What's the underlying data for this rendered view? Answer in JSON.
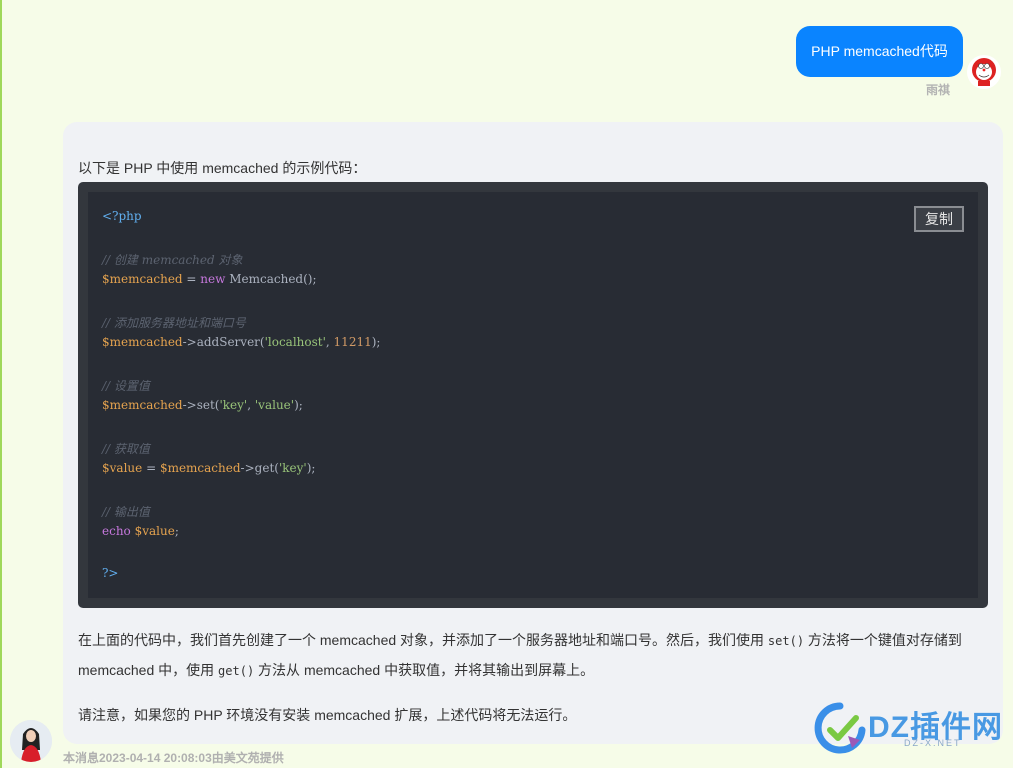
{
  "user_message": {
    "text": "PHP memcached代码",
    "sender": "雨祺"
  },
  "bot_message": {
    "intro": "以下是 PHP 中使用 memcached 的示例代码：",
    "copy_label": "复制",
    "code": {
      "open_tag": "<?php",
      "c1": "// 创建 memcached 对象",
      "l1_var": "$memcached",
      "l1_eq": " = ",
      "l1_kw": "new",
      "l1_rest": " Memcached();",
      "c2": "// 添加服务器地址和端口号",
      "l2_var": "$memcached",
      "l2_call": "->addServer(",
      "l2_str": "'localhost'",
      "l2_sep": ", ",
      "l2_num": "11211",
      "l2_end": ");",
      "c3": "// 设置值",
      "l3_var": "$memcached",
      "l3_call": "->set(",
      "l3_str1": "'key'",
      "l3_sep": ", ",
      "l3_str2": "'value'",
      "l3_end": ");",
      "c4": "// 获取值",
      "l4_var1": "$value",
      "l4_eq": " = ",
      "l4_var2": "$memcached",
      "l4_call": "->get(",
      "l4_str": "'key'",
      "l4_end": ");",
      "c5": "// 输出值",
      "l5_kw": "echo",
      "l5_sp": " ",
      "l5_var": "$value",
      "l5_end": ";",
      "close_tag": "?>"
    },
    "para1_a": "在上面的代码中，我们首先创建了一个 memcached 对象，并添加了一个服务器地址和端口号。然后，我们使用 ",
    "para1_code1": "set()",
    "para1_b": " 方法将一个键值对存储到",
    "para2_a": "memcached 中，使用 ",
    "para2_code": "get()",
    "para2_b": " 方法从 memcached 中获取值，并将其输出到屏幕上。",
    "para3": "请注意，如果您的 PHP 环境没有安装 memcached 扩展，上述代码将无法运行。"
  },
  "footer": {
    "note": "本消息2023-04-14 20:08:03由美文苑提供"
  },
  "watermark": {
    "text": "DZ插件网",
    "sub": "DZ-X.NET"
  },
  "colors": {
    "user_bubble": "#0a84ff",
    "code_bg": "#282c34",
    "page_bg": "#f6fce8"
  }
}
